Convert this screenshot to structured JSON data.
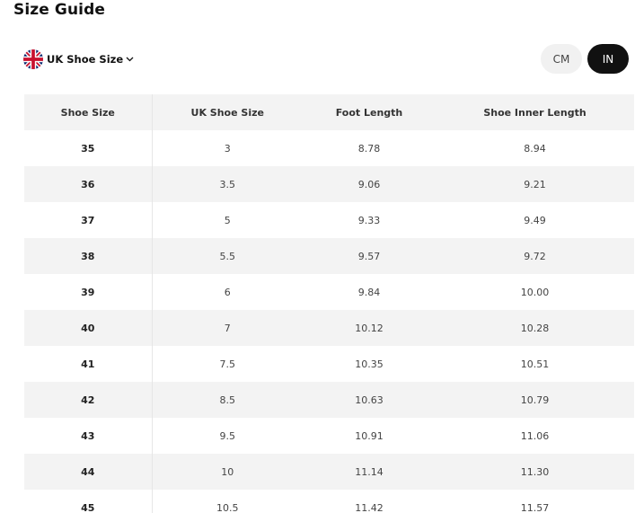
{
  "title": "Size Guide",
  "region_select": {
    "label": "UK Shoe Size",
    "flag_icon": "uk-flag-icon"
  },
  "unit_toggle": {
    "options": [
      "CM",
      "IN"
    ],
    "selected": "IN"
  },
  "colors": {
    "selected_toggle_bg": "#111111",
    "toggle_bg": "#f1f1f1",
    "row_shade": "#f3f3f3"
  },
  "table": {
    "headers": [
      "Shoe Size",
      "UK Shoe Size",
      "Foot Length",
      "Shoe Inner Length"
    ],
    "rows": [
      [
        "35",
        "3",
        "8.78",
        "8.94"
      ],
      [
        "36",
        "3.5",
        "9.06",
        "9.21"
      ],
      [
        "37",
        "5",
        "9.33",
        "9.49"
      ],
      [
        "38",
        "5.5",
        "9.57",
        "9.72"
      ],
      [
        "39",
        "6",
        "9.84",
        "10.00"
      ],
      [
        "40",
        "7",
        "10.12",
        "10.28"
      ],
      [
        "41",
        "7.5",
        "10.35",
        "10.51"
      ],
      [
        "42",
        "8.5",
        "10.63",
        "10.79"
      ],
      [
        "43",
        "9.5",
        "10.91",
        "11.06"
      ],
      [
        "44",
        "10",
        "11.14",
        "11.30"
      ],
      [
        "45",
        "10.5",
        "11.42",
        "11.57"
      ]
    ]
  }
}
